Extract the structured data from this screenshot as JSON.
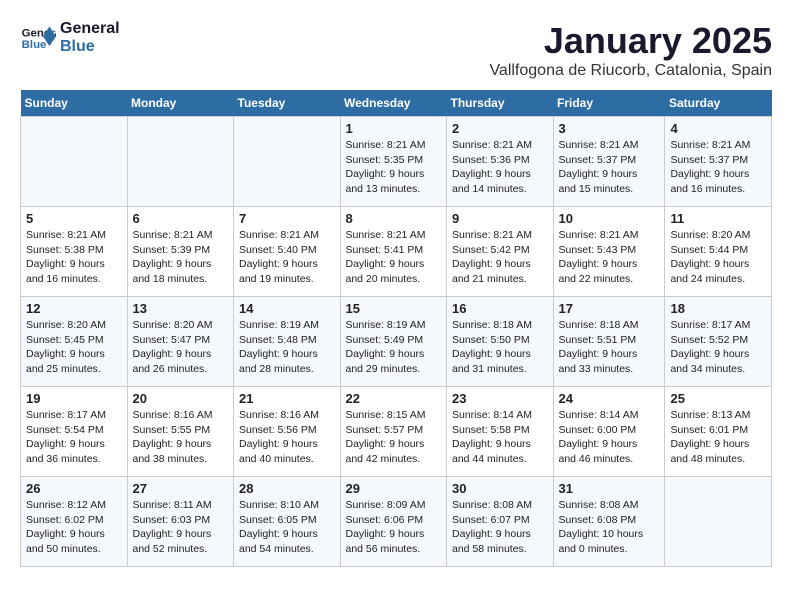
{
  "logo": {
    "line1": "General",
    "line2": "Blue"
  },
  "title": "January 2025",
  "subtitle": "Vallfogona de Riucorb, Catalonia, Spain",
  "weekdays": [
    "Sunday",
    "Monday",
    "Tuesday",
    "Wednesday",
    "Thursday",
    "Friday",
    "Saturday"
  ],
  "weeks": [
    [
      {
        "day": "",
        "info": ""
      },
      {
        "day": "",
        "info": ""
      },
      {
        "day": "",
        "info": ""
      },
      {
        "day": "1",
        "info": "Sunrise: 8:21 AM\nSunset: 5:35 PM\nDaylight: 9 hours\nand 13 minutes."
      },
      {
        "day": "2",
        "info": "Sunrise: 8:21 AM\nSunset: 5:36 PM\nDaylight: 9 hours\nand 14 minutes."
      },
      {
        "day": "3",
        "info": "Sunrise: 8:21 AM\nSunset: 5:37 PM\nDaylight: 9 hours\nand 15 minutes."
      },
      {
        "day": "4",
        "info": "Sunrise: 8:21 AM\nSunset: 5:37 PM\nDaylight: 9 hours\nand 16 minutes."
      }
    ],
    [
      {
        "day": "5",
        "info": "Sunrise: 8:21 AM\nSunset: 5:38 PM\nDaylight: 9 hours\nand 16 minutes."
      },
      {
        "day": "6",
        "info": "Sunrise: 8:21 AM\nSunset: 5:39 PM\nDaylight: 9 hours\nand 18 minutes."
      },
      {
        "day": "7",
        "info": "Sunrise: 8:21 AM\nSunset: 5:40 PM\nDaylight: 9 hours\nand 19 minutes."
      },
      {
        "day": "8",
        "info": "Sunrise: 8:21 AM\nSunset: 5:41 PM\nDaylight: 9 hours\nand 20 minutes."
      },
      {
        "day": "9",
        "info": "Sunrise: 8:21 AM\nSunset: 5:42 PM\nDaylight: 9 hours\nand 21 minutes."
      },
      {
        "day": "10",
        "info": "Sunrise: 8:21 AM\nSunset: 5:43 PM\nDaylight: 9 hours\nand 22 minutes."
      },
      {
        "day": "11",
        "info": "Sunrise: 8:20 AM\nSunset: 5:44 PM\nDaylight: 9 hours\nand 24 minutes."
      }
    ],
    [
      {
        "day": "12",
        "info": "Sunrise: 8:20 AM\nSunset: 5:45 PM\nDaylight: 9 hours\nand 25 minutes."
      },
      {
        "day": "13",
        "info": "Sunrise: 8:20 AM\nSunset: 5:47 PM\nDaylight: 9 hours\nand 26 minutes."
      },
      {
        "day": "14",
        "info": "Sunrise: 8:19 AM\nSunset: 5:48 PM\nDaylight: 9 hours\nand 28 minutes."
      },
      {
        "day": "15",
        "info": "Sunrise: 8:19 AM\nSunset: 5:49 PM\nDaylight: 9 hours\nand 29 minutes."
      },
      {
        "day": "16",
        "info": "Sunrise: 8:18 AM\nSunset: 5:50 PM\nDaylight: 9 hours\nand 31 minutes."
      },
      {
        "day": "17",
        "info": "Sunrise: 8:18 AM\nSunset: 5:51 PM\nDaylight: 9 hours\nand 33 minutes."
      },
      {
        "day": "18",
        "info": "Sunrise: 8:17 AM\nSunset: 5:52 PM\nDaylight: 9 hours\nand 34 minutes."
      }
    ],
    [
      {
        "day": "19",
        "info": "Sunrise: 8:17 AM\nSunset: 5:54 PM\nDaylight: 9 hours\nand 36 minutes."
      },
      {
        "day": "20",
        "info": "Sunrise: 8:16 AM\nSunset: 5:55 PM\nDaylight: 9 hours\nand 38 minutes."
      },
      {
        "day": "21",
        "info": "Sunrise: 8:16 AM\nSunset: 5:56 PM\nDaylight: 9 hours\nand 40 minutes."
      },
      {
        "day": "22",
        "info": "Sunrise: 8:15 AM\nSunset: 5:57 PM\nDaylight: 9 hours\nand 42 minutes."
      },
      {
        "day": "23",
        "info": "Sunrise: 8:14 AM\nSunset: 5:58 PM\nDaylight: 9 hours\nand 44 minutes."
      },
      {
        "day": "24",
        "info": "Sunrise: 8:14 AM\nSunset: 6:00 PM\nDaylight: 9 hours\nand 46 minutes."
      },
      {
        "day": "25",
        "info": "Sunrise: 8:13 AM\nSunset: 6:01 PM\nDaylight: 9 hours\nand 48 minutes."
      }
    ],
    [
      {
        "day": "26",
        "info": "Sunrise: 8:12 AM\nSunset: 6:02 PM\nDaylight: 9 hours\nand 50 minutes."
      },
      {
        "day": "27",
        "info": "Sunrise: 8:11 AM\nSunset: 6:03 PM\nDaylight: 9 hours\nand 52 minutes."
      },
      {
        "day": "28",
        "info": "Sunrise: 8:10 AM\nSunset: 6:05 PM\nDaylight: 9 hours\nand 54 minutes."
      },
      {
        "day": "29",
        "info": "Sunrise: 8:09 AM\nSunset: 6:06 PM\nDaylight: 9 hours\nand 56 minutes."
      },
      {
        "day": "30",
        "info": "Sunrise: 8:08 AM\nSunset: 6:07 PM\nDaylight: 9 hours\nand 58 minutes."
      },
      {
        "day": "31",
        "info": "Sunrise: 8:08 AM\nSunset: 6:08 PM\nDaylight: 10 hours\nand 0 minutes."
      },
      {
        "day": "",
        "info": ""
      }
    ]
  ]
}
